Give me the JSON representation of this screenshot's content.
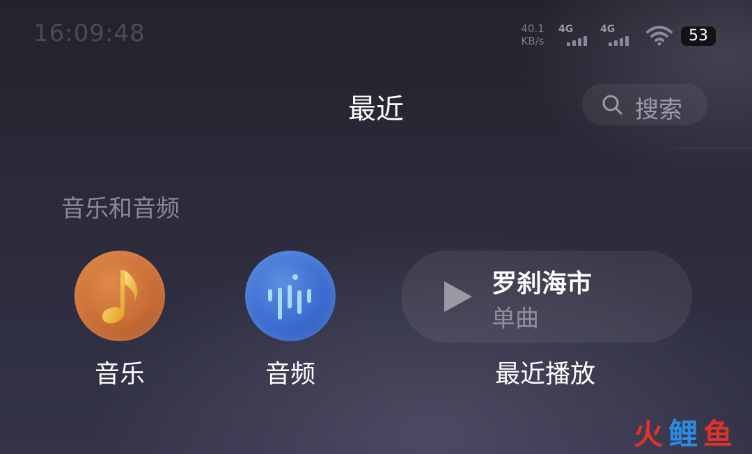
{
  "status_bar": {
    "time": "16:09:48",
    "net_speed_value": "40.1",
    "net_speed_unit": "KB/s",
    "signal_1_label": "4G",
    "signal_2_label": "4G",
    "battery_level": "53",
    "icons": [
      "signal-icon",
      "wifi-icon",
      "battery-icon"
    ]
  },
  "header": {
    "title": "最近",
    "search_label": "搜索",
    "search_icon": "search-icon"
  },
  "section": {
    "title": "音乐和音频"
  },
  "apps": [
    {
      "label": "音乐",
      "icon": "music-note-icon",
      "color": "#c86c35"
    },
    {
      "label": "音频",
      "icon": "audio-wave-icon",
      "color": "#3a6cd0"
    }
  ],
  "recent": {
    "track_title": "罗刹海市",
    "track_type": "单曲",
    "label": "最近播放",
    "icon": "play-icon"
  },
  "watermark": {
    "text_1": "火",
    "text_2": "鲤",
    "text_3": "鱼"
  }
}
